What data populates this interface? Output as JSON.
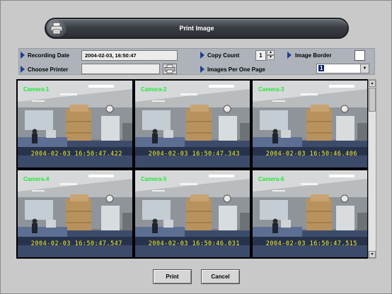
{
  "window": {
    "title": "Print Image"
  },
  "options": {
    "recording_date_label": "Recording Date",
    "recording_date_value": "2004-02-03,  16:50:47",
    "choose_printer_label": "Choose Printer",
    "choose_printer_value": "",
    "copy_count_label": "Copy Count",
    "copy_count_value": "1",
    "image_border_label": "Image Border",
    "image_border_checked": false,
    "images_per_page_label": "Images Per One Page",
    "images_per_page_value": "1"
  },
  "cameras": [
    {
      "name": "Camera-1",
      "timestamp": "2004-02-03  16:50:47.422"
    },
    {
      "name": "Camera-2",
      "timestamp": "2004-02-03  16:50:47.343"
    },
    {
      "name": "Camera-3",
      "timestamp": "2004-02-03  16:50:46.406"
    },
    {
      "name": "Camera-4",
      "timestamp": "2004-02-03  16:50:47.547"
    },
    {
      "name": "Camera-5",
      "timestamp": "2004-02-03  16:50:46.031"
    },
    {
      "name": "Camera-6",
      "timestamp": "2004-02-03  16:50:47.515"
    }
  ],
  "buttons": {
    "print": "Print",
    "cancel": "Cancel"
  },
  "icons": {
    "title": "printer-icon",
    "printer_picker": "printer-icon",
    "spin_up": "up-arrow-icon",
    "spin_down": "down-arrow-icon",
    "dropdown": "chevron-down-icon",
    "row_marker": "triangle-right-icon"
  },
  "colors": {
    "camera_label": "#23e838",
    "timestamp": "#f5ef2a",
    "option_panel": "#aeb3bb",
    "titlebar": "#3a3e44"
  }
}
